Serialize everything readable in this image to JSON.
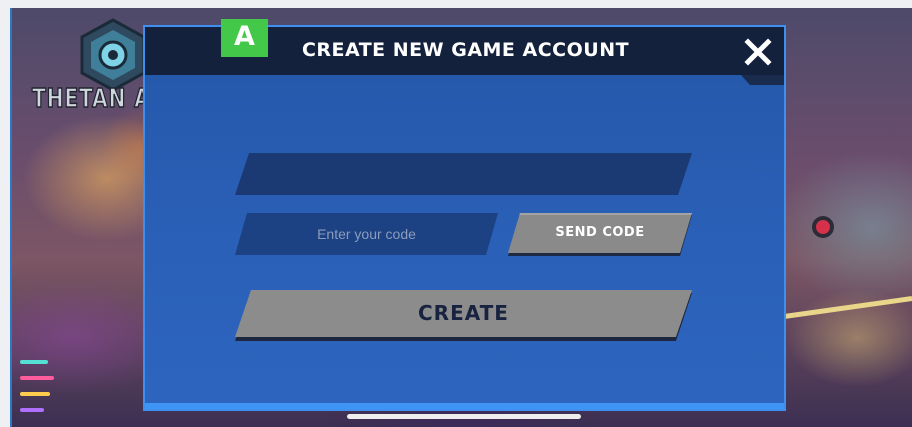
{
  "background": {
    "logo_text": "THETAN AF"
  },
  "dialog": {
    "badge": "A",
    "title": "CREATE NEW GAME ACCOUNT",
    "close_icon": "close-icon",
    "email_field": {
      "value": "",
      "placeholder": ""
    },
    "code_field": {
      "value": "",
      "placeholder": "Enter your code"
    },
    "send_code_label": "SEND CODE",
    "create_label": "CREATE"
  },
  "colors": {
    "dialog_bg": "#2a5fb6",
    "header_bg": "#13213d",
    "badge_green": "#43c84a",
    "button_gray": "#8c8c8c",
    "border_blue": "#3f8ff0"
  }
}
